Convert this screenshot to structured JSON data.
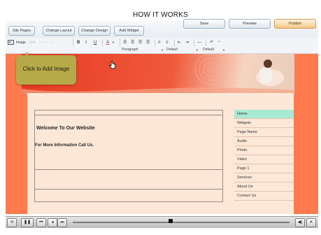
{
  "page_title": "HOW IT WORKS",
  "header_buttons": {
    "site_pages": "Site Pages",
    "change_layout": "Change Layout",
    "change_design": "Change Design",
    "add_widget": "Add Widget",
    "save": "Save",
    "preview": "Preview",
    "publish": "Publish"
  },
  "toolbar": {
    "image": "Image",
    "link": "Link",
    "bold": "B",
    "italic": "I",
    "underline": "U",
    "text_color": "A",
    "format_select": "Paragraph",
    "font_select": "Default",
    "size_select": "Default"
  },
  "tooltip": {
    "text": "Click to Add Image"
  },
  "content": {
    "welcome": "Welcome To Our Website",
    "info": "For More Information Call Us."
  },
  "nav": {
    "items": [
      {
        "label": "Home"
      },
      {
        "label": "Widgets"
      },
      {
        "label": "Page Name"
      },
      {
        "label": "Audio"
      },
      {
        "label": "Photo"
      },
      {
        "label": "Video"
      },
      {
        "label": "Page 1"
      },
      {
        "label": "Services"
      },
      {
        "label": "About Us"
      },
      {
        "label": "Contact Us"
      }
    ]
  },
  "player": {
    "progress": 0.45
  },
  "colors": {
    "accent": "#ff7a4e",
    "content_bg": "#fde8d8",
    "tooltip_bg": "#b5a94a",
    "nav_active": "#a8ead3"
  }
}
